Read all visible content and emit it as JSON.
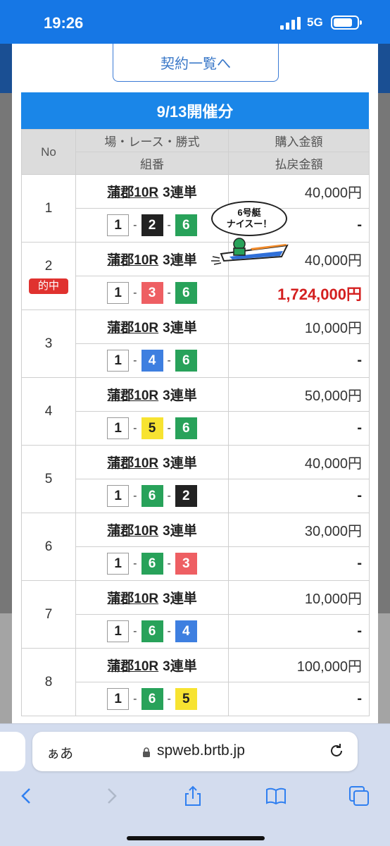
{
  "status_bar": {
    "time": "19:26",
    "network": "5G"
  },
  "contract_button": "契約一覧へ",
  "section_header": "9/13開催分",
  "table_headers": {
    "no": "No",
    "race_top": "場・レース・勝式",
    "race_bottom": "組番",
    "amount_top": "購入金額",
    "amount_bottom": "払戻金額"
  },
  "rows": [
    {
      "no": "1",
      "race": "蒲郡10R",
      "type": "3連単",
      "combo": [
        "1",
        "2",
        "6"
      ],
      "amount": "40,000円",
      "payout": "-",
      "hit": false
    },
    {
      "no": "2",
      "race": "蒲郡10R",
      "type": "3連単",
      "combo": [
        "1",
        "3",
        "6"
      ],
      "amount": "40,000円",
      "payout": "1,724,000円",
      "hit": true,
      "hit_label": "的中"
    },
    {
      "no": "3",
      "race": "蒲郡10R",
      "type": "3連単",
      "combo": [
        "1",
        "4",
        "6"
      ],
      "amount": "10,000円",
      "payout": "-",
      "hit": false
    },
    {
      "no": "4",
      "race": "蒲郡10R",
      "type": "3連単",
      "combo": [
        "1",
        "5",
        "6"
      ],
      "amount": "50,000円",
      "payout": "-",
      "hit": false
    },
    {
      "no": "5",
      "race": "蒲郡10R",
      "type": "3連単",
      "combo": [
        "1",
        "6",
        "2"
      ],
      "amount": "40,000円",
      "payout": "-",
      "hit": false
    },
    {
      "no": "6",
      "race": "蒲郡10R",
      "type": "3連単",
      "combo": [
        "1",
        "6",
        "3"
      ],
      "amount": "30,000円",
      "payout": "-",
      "hit": false
    },
    {
      "no": "7",
      "race": "蒲郡10R",
      "type": "3連単",
      "combo": [
        "1",
        "6",
        "4"
      ],
      "amount": "10,000円",
      "payout": "-",
      "hit": false
    },
    {
      "no": "8",
      "race": "蒲郡10R",
      "type": "3連単",
      "combo": [
        "1",
        "6",
        "5"
      ],
      "amount": "100,000円",
      "payout": "-",
      "hit": false
    }
  ],
  "bubble": {
    "line1": "6号艇",
    "line2": "ナイスー！"
  },
  "browser": {
    "aa_label": "ぁあ",
    "url": "spweb.brtb.jp"
  },
  "icons": [
    "signal-icon",
    "battery-icon",
    "lock-icon",
    "reload-icon",
    "back-icon",
    "forward-icon",
    "share-icon",
    "bookmarks-icon",
    "tabs-icon"
  ]
}
